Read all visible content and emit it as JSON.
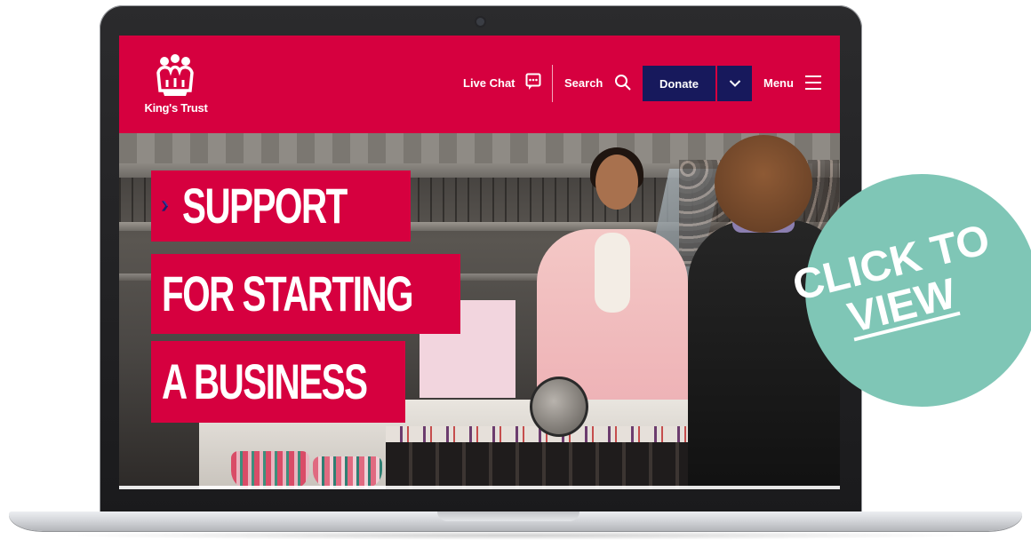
{
  "site": {
    "logo_text": "King's Trust"
  },
  "header": {
    "live_chat_label": "Live Chat",
    "search_label": "Search",
    "donate_label": "Donate",
    "menu_label": "Menu"
  },
  "hero": {
    "title_lines": [
      "SUPPORT",
      "FOR STARTING",
      "A BUSINESS"
    ]
  },
  "badge": {
    "line1": "CLICK TO",
    "line2": "VIEW"
  },
  "colors": {
    "brand_red": "#d6003f",
    "donate_navy": "#17195c",
    "badge_teal": "#7fc6b6"
  },
  "icons": [
    "crown-logo-icon",
    "chat-icon",
    "search-icon",
    "chevron-down-icon",
    "hamburger-menu-icon",
    "chevron-right-icon"
  ]
}
